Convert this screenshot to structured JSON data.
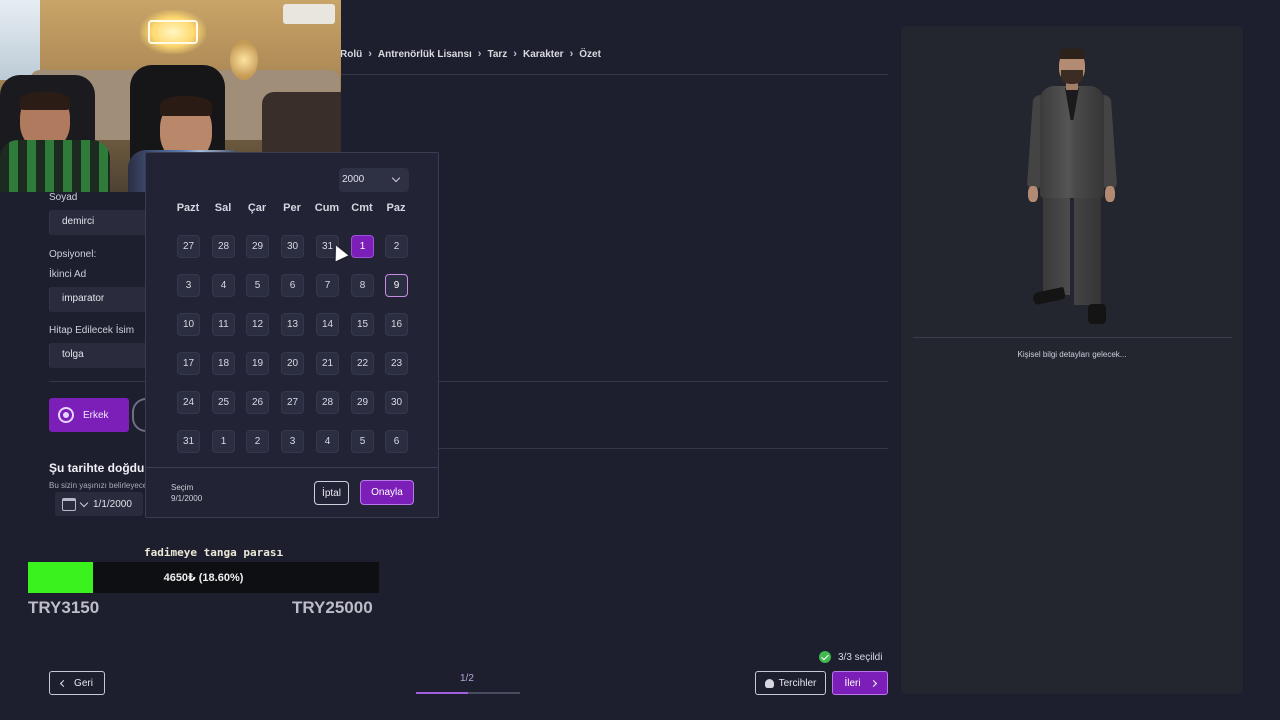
{
  "breadcrumb": [
    "Rolü",
    "Antrenörlük Lisansı",
    "Tarz",
    "Karakter",
    "Özet"
  ],
  "form": {
    "surname_label": "Soyad",
    "surname_value": "demirci",
    "optional_label": "Opsiyonel:",
    "middle_name_label": "İkinci Ad",
    "middle_name_value": "imparator",
    "nickname_label": "Hitap Edilecek İsim",
    "nickname_value": "tolga",
    "gender_selected": "Erkek",
    "birth_title": "Şu tarihte doğdu",
    "birth_subtitle": "Bu sizin yaşınızı belirleyecek",
    "birth_value": "1/1/2000"
  },
  "datepicker": {
    "year_select": "2000",
    "weekdays": [
      "Pazt",
      "Sal",
      "Çar",
      "Per",
      "Cum",
      "Cmt",
      "Paz"
    ],
    "weeks": [
      [
        "27",
        "28",
        "29",
        "30",
        "31",
        "1",
        "2"
      ],
      [
        "3",
        "4",
        "5",
        "6",
        "7",
        "8",
        "9"
      ],
      [
        "10",
        "11",
        "12",
        "13",
        "14",
        "15",
        "16"
      ],
      [
        "17",
        "18",
        "19",
        "20",
        "21",
        "22",
        "23"
      ],
      [
        "24",
        "25",
        "26",
        "27",
        "28",
        "29",
        "30"
      ],
      [
        "31",
        "1",
        "2",
        "3",
        "4",
        "5",
        "6"
      ]
    ],
    "selected_day": "1",
    "today_day": "9",
    "selection_label": "Seçim",
    "selection_value": "9/1/2000",
    "cancel_label": "İptal",
    "confirm_label": "Onayla"
  },
  "donation": {
    "title": "fadimeye tanga parası",
    "progress_fraction": 0.186,
    "current_text": "4650₺ (18.60%)",
    "min_label": "TRY3150",
    "max_label": "TRY25000"
  },
  "footer": {
    "back_label": "Geri",
    "page_indicator": "1/2",
    "page_progress_fraction": 0.5,
    "selected_count": "3/3 seçildi",
    "preferences_label": "Tercihler",
    "next_label": "İleri"
  },
  "right_panel": {
    "info_text": "Kişisel bilgi detayları gelecek..."
  },
  "colors": {
    "accent": "#7b1fb8",
    "background": "#1d1f2e",
    "progress_green": "#3af21e",
    "check_green": "#3fb950"
  },
  "icons": [
    "calendar-icon",
    "chevron-down-icon",
    "chevron-left-icon",
    "chevron-right-icon",
    "check-circle-icon",
    "preferences-icon",
    "radio-icon"
  ]
}
